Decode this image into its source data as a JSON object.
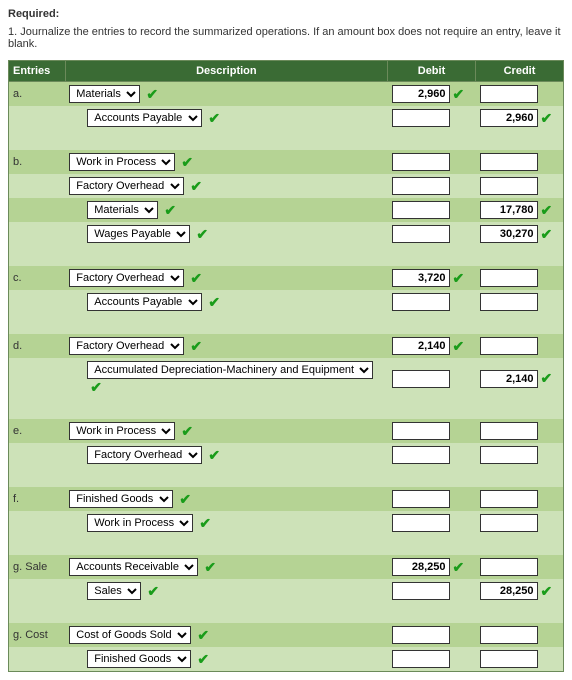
{
  "required_label": "Required:",
  "instruction": "1. Journalize the entries to record the summarized operations. If an amount box does not require an entry, leave it blank.",
  "headers": {
    "entries": "Entries",
    "description": "Description",
    "debit": "Debit",
    "credit": "Credit"
  },
  "accounts": {
    "materials": "Materials",
    "accounts_payable": "Accounts Payable",
    "work_in_process": "Work in Process",
    "factory_overhead": "Factory Overhead",
    "wages_payable": "Wages Payable",
    "accum_depr": "Accumulated Depreciation-Machinery and Equipment",
    "finished_goods": "Finished Goods",
    "accounts_receivable": "Accounts Receivable",
    "sales": "Sales",
    "cogs": "Cost of Goods Sold"
  },
  "labels": {
    "a": "a.",
    "b": "b.",
    "c": "c.",
    "d": "d.",
    "e": "e.",
    "f": "f.",
    "g_sale": "g. Sale",
    "g_cost": "g. Cost"
  },
  "values": {
    "a_debit": "2,960",
    "a_credit": "2,960",
    "b_mat_credit": "17,780",
    "b_wages_credit": "30,270",
    "c_debit": "3,720",
    "d_debit": "2,140",
    "d_credit": "2,140",
    "g_sale_debit": "28,250",
    "g_sale_credit": "28,250"
  }
}
